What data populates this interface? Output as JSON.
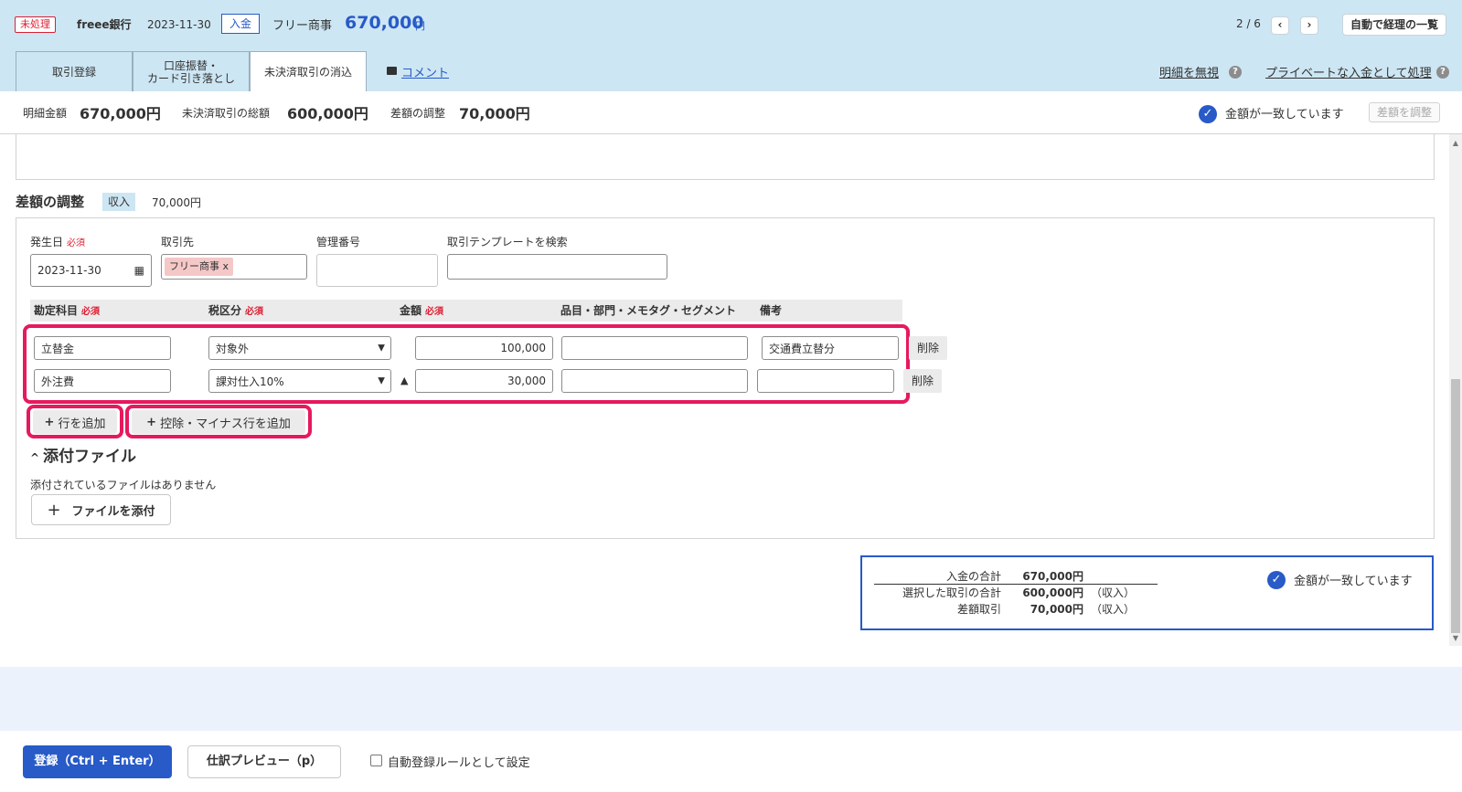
{
  "header": {
    "status": "未処理",
    "bank": "freee銀行",
    "date": "2023-11-30",
    "type": "入金",
    "partner": "フリー商事",
    "amount": "670,000",
    "currency": "円",
    "pager": "2 / 6",
    "prev": "‹",
    "next": "›",
    "list_button": "自動で経理の一覧"
  },
  "tabs": [
    {
      "label": "取引登録"
    },
    {
      "label": "口座振替・\nカード引き落とし"
    },
    {
      "label": "未決済取引の消込"
    }
  ],
  "comment_link": "コメント",
  "ignore_link": "明細を無視",
  "private_link": "プライベートな入金として処理",
  "summary": {
    "detail_label": "明細金額",
    "detail_value": "670,000円",
    "unsettled_label": "未決済取引の総額",
    "unsettled_value": "600,000円",
    "diff_label": "差額の調整",
    "diff_value": "70,000円",
    "match_text": "金額が一致しています",
    "adjust_button": "差額を調整"
  },
  "adjust_section": {
    "title": "差額の調整",
    "badge": "収入",
    "amount": "70,000円"
  },
  "form": {
    "date_label": "発生日",
    "required": "必須",
    "date_value": "2023-11-30",
    "partner_label": "取引先",
    "partner_tag": "フリー商事 x",
    "mgmt_label": "管理番号",
    "template_label": "取引テンプレートを検索"
  },
  "table": {
    "headers": [
      "勘定科目",
      "税区分",
      "金額",
      "品目・部門・メモタグ・セグメント",
      "備考"
    ],
    "rows": [
      {
        "account": "立替金",
        "tax": "対象外",
        "mark": "",
        "amount": "100,000",
        "tags": "",
        "memo": "交通費立替分",
        "delete": "削除"
      },
      {
        "account": "外注費",
        "tax": "課対仕入10%",
        "mark": "▲",
        "amount": "30,000",
        "tags": "",
        "memo": "",
        "delete": "削除"
      }
    ],
    "add_row": "行を追加",
    "add_minus_row": "控除・マイナス行を追加"
  },
  "attachments": {
    "title": "添付ファイル",
    "empty_note": "添付されているファイルはありません",
    "add_button": "ファイルを添付"
  },
  "totals": {
    "deposit_label": "入金の合計",
    "deposit_value": "670,000円",
    "selected_label": "選択した取引の合計",
    "selected_value": "600,000円",
    "selected_note": "（収入）",
    "diff_label": "差額取引",
    "diff_value": "70,000円",
    "diff_note": "（収入）",
    "match_text": "金額が一致しています"
  },
  "footer": {
    "register": "登録（Ctrl + Enter）",
    "preview": "仕訳プレビュー（p）",
    "auto_rule": "自動登録ルールとして設定"
  },
  "colors": {
    "accent": "#285ac8",
    "header_bg": "#cde6f3",
    "highlight": "#e6195f",
    "required": "#dc1e32"
  }
}
